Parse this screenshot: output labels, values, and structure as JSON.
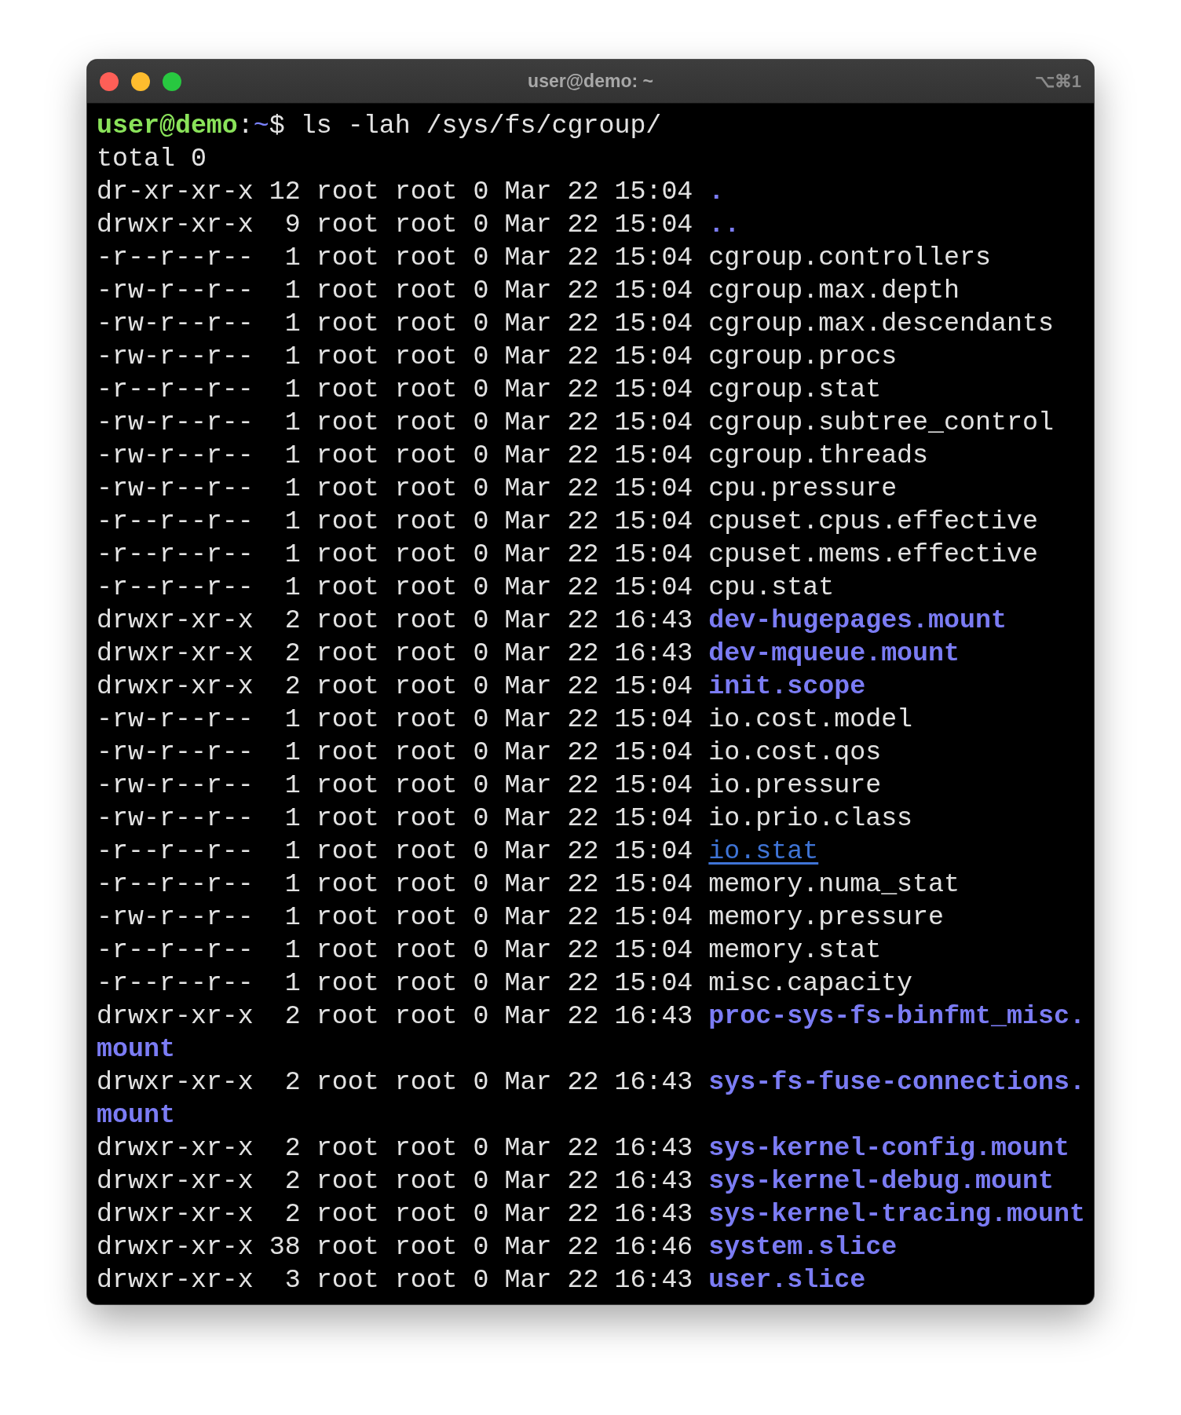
{
  "window": {
    "title": "user@demo: ~",
    "shortcut": "⌥⌘1"
  },
  "prompt": {
    "user_host": "user@demo",
    "separator": ":",
    "path": "~",
    "symbol": "$",
    "command": "ls -lah /sys/fs/cgroup/"
  },
  "total": "total 0",
  "rows": [
    {
      "mode": "dr-xr-xr-x",
      "links": "12",
      "owner": "root",
      "group": "root",
      "size": "0",
      "date": "Mar 22",
      "time": "15:04",
      "name": ".",
      "kind": "dir"
    },
    {
      "mode": "drwxr-xr-x",
      "links": "9",
      "owner": "root",
      "group": "root",
      "size": "0",
      "date": "Mar 22",
      "time": "15:04",
      "name": "..",
      "kind": "dir"
    },
    {
      "mode": "-r--r--r--",
      "links": "1",
      "owner": "root",
      "group": "root",
      "size": "0",
      "date": "Mar 22",
      "time": "15:04",
      "name": "cgroup.controllers",
      "kind": "file"
    },
    {
      "mode": "-rw-r--r--",
      "links": "1",
      "owner": "root",
      "group": "root",
      "size": "0",
      "date": "Mar 22",
      "time": "15:04",
      "name": "cgroup.max.depth",
      "kind": "file"
    },
    {
      "mode": "-rw-r--r--",
      "links": "1",
      "owner": "root",
      "group": "root",
      "size": "0",
      "date": "Mar 22",
      "time": "15:04",
      "name": "cgroup.max.descendants",
      "kind": "file"
    },
    {
      "mode": "-rw-r--r--",
      "links": "1",
      "owner": "root",
      "group": "root",
      "size": "0",
      "date": "Mar 22",
      "time": "15:04",
      "name": "cgroup.procs",
      "kind": "file"
    },
    {
      "mode": "-r--r--r--",
      "links": "1",
      "owner": "root",
      "group": "root",
      "size": "0",
      "date": "Mar 22",
      "time": "15:04",
      "name": "cgroup.stat",
      "kind": "file"
    },
    {
      "mode": "-rw-r--r--",
      "links": "1",
      "owner": "root",
      "group": "root",
      "size": "0",
      "date": "Mar 22",
      "time": "15:04",
      "name": "cgroup.subtree_control",
      "kind": "file"
    },
    {
      "mode": "-rw-r--r--",
      "links": "1",
      "owner": "root",
      "group": "root",
      "size": "0",
      "date": "Mar 22",
      "time": "15:04",
      "name": "cgroup.threads",
      "kind": "file"
    },
    {
      "mode": "-rw-r--r--",
      "links": "1",
      "owner": "root",
      "group": "root",
      "size": "0",
      "date": "Mar 22",
      "time": "15:04",
      "name": "cpu.pressure",
      "kind": "file"
    },
    {
      "mode": "-r--r--r--",
      "links": "1",
      "owner": "root",
      "group": "root",
      "size": "0",
      "date": "Mar 22",
      "time": "15:04",
      "name": "cpuset.cpus.effective",
      "kind": "file"
    },
    {
      "mode": "-r--r--r--",
      "links": "1",
      "owner": "root",
      "group": "root",
      "size": "0",
      "date": "Mar 22",
      "time": "15:04",
      "name": "cpuset.mems.effective",
      "kind": "file"
    },
    {
      "mode": "-r--r--r--",
      "links": "1",
      "owner": "root",
      "group": "root",
      "size": "0",
      "date": "Mar 22",
      "time": "15:04",
      "name": "cpu.stat",
      "kind": "file"
    },
    {
      "mode": "drwxr-xr-x",
      "links": "2",
      "owner": "root",
      "group": "root",
      "size": "0",
      "date": "Mar 22",
      "time": "16:43",
      "name": "dev-hugepages.mount",
      "kind": "dir"
    },
    {
      "mode": "drwxr-xr-x",
      "links": "2",
      "owner": "root",
      "group": "root",
      "size": "0",
      "date": "Mar 22",
      "time": "16:43",
      "name": "dev-mqueue.mount",
      "kind": "dir"
    },
    {
      "mode": "drwxr-xr-x",
      "links": "2",
      "owner": "root",
      "group": "root",
      "size": "0",
      "date": "Mar 22",
      "time": "15:04",
      "name": "init.scope",
      "kind": "dir"
    },
    {
      "mode": "-rw-r--r--",
      "links": "1",
      "owner": "root",
      "group": "root",
      "size": "0",
      "date": "Mar 22",
      "time": "15:04",
      "name": "io.cost.model",
      "kind": "file"
    },
    {
      "mode": "-rw-r--r--",
      "links": "1",
      "owner": "root",
      "group": "root",
      "size": "0",
      "date": "Mar 22",
      "time": "15:04",
      "name": "io.cost.qos",
      "kind": "file"
    },
    {
      "mode": "-rw-r--r--",
      "links": "1",
      "owner": "root",
      "group": "root",
      "size": "0",
      "date": "Mar 22",
      "time": "15:04",
      "name": "io.pressure",
      "kind": "file"
    },
    {
      "mode": "-rw-r--r--",
      "links": "1",
      "owner": "root",
      "group": "root",
      "size": "0",
      "date": "Mar 22",
      "time": "15:04",
      "name": "io.prio.class",
      "kind": "file"
    },
    {
      "mode": "-r--r--r--",
      "links": "1",
      "owner": "root",
      "group": "root",
      "size": "0",
      "date": "Mar 22",
      "time": "15:04",
      "name": "io.stat",
      "kind": "link"
    },
    {
      "mode": "-r--r--r--",
      "links": "1",
      "owner": "root",
      "group": "root",
      "size": "0",
      "date": "Mar 22",
      "time": "15:04",
      "name": "memory.numa_stat",
      "kind": "file"
    },
    {
      "mode": "-rw-r--r--",
      "links": "1",
      "owner": "root",
      "group": "root",
      "size": "0",
      "date": "Mar 22",
      "time": "15:04",
      "name": "memory.pressure",
      "kind": "file"
    },
    {
      "mode": "-r--r--r--",
      "links": "1",
      "owner": "root",
      "group": "root",
      "size": "0",
      "date": "Mar 22",
      "time": "15:04",
      "name": "memory.stat",
      "kind": "file"
    },
    {
      "mode": "-r--r--r--",
      "links": "1",
      "owner": "root",
      "group": "root",
      "size": "0",
      "date": "Mar 22",
      "time": "15:04",
      "name": "misc.capacity",
      "kind": "file"
    },
    {
      "mode": "drwxr-xr-x",
      "links": "2",
      "owner": "root",
      "group": "root",
      "size": "0",
      "date": "Mar 22",
      "time": "16:43",
      "name": "proc-sys-fs-binfmt_misc.mount",
      "kind": "dir"
    },
    {
      "mode": "drwxr-xr-x",
      "links": "2",
      "owner": "root",
      "group": "root",
      "size": "0",
      "date": "Mar 22",
      "time": "16:43",
      "name": "sys-fs-fuse-connections.mount",
      "kind": "dir"
    },
    {
      "mode": "drwxr-xr-x",
      "links": "2",
      "owner": "root",
      "group": "root",
      "size": "0",
      "date": "Mar 22",
      "time": "16:43",
      "name": "sys-kernel-config.mount",
      "kind": "dir"
    },
    {
      "mode": "drwxr-xr-x",
      "links": "2",
      "owner": "root",
      "group": "root",
      "size": "0",
      "date": "Mar 22",
      "time": "16:43",
      "name": "sys-kernel-debug.mount",
      "kind": "dir"
    },
    {
      "mode": "drwxr-xr-x",
      "links": "2",
      "owner": "root",
      "group": "root",
      "size": "0",
      "date": "Mar 22",
      "time": "16:43",
      "name": "sys-kernel-tracing.mount",
      "kind": "dir"
    },
    {
      "mode": "drwxr-xr-x",
      "links": "38",
      "owner": "root",
      "group": "root",
      "size": "0",
      "date": "Mar 22",
      "time": "16:46",
      "name": "system.slice",
      "kind": "dir"
    },
    {
      "mode": "drwxr-xr-x",
      "links": "3",
      "owner": "root",
      "group": "root",
      "size": "0",
      "date": "Mar 22",
      "time": "16:43",
      "name": "user.slice",
      "kind": "dir"
    }
  ]
}
